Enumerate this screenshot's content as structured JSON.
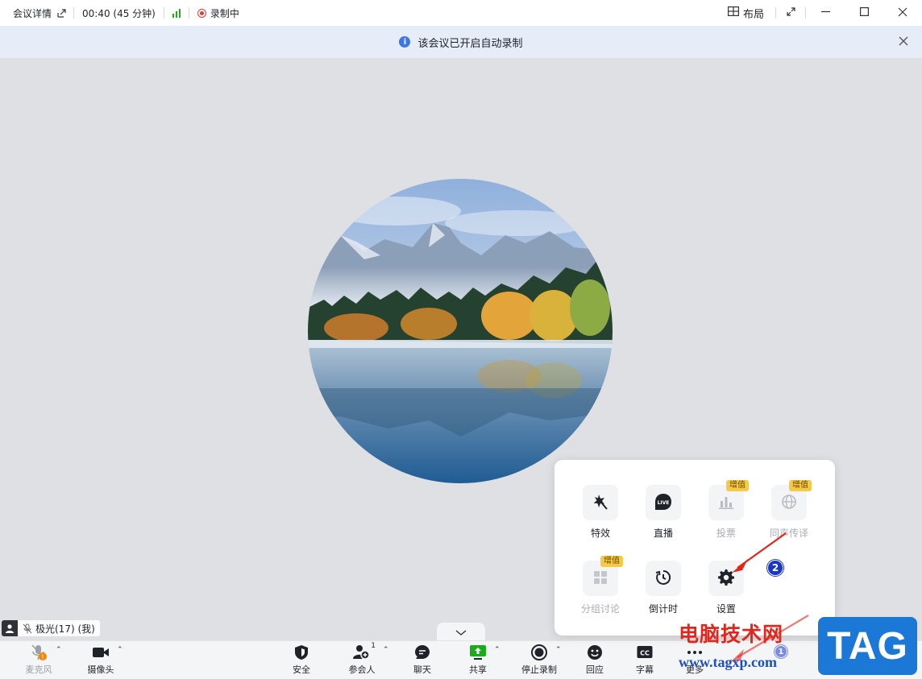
{
  "titlebar": {
    "title": "会议详情",
    "time": "00:40 (45 分钟)",
    "recording": "录制中",
    "layout": "布局"
  },
  "notice": {
    "text": "该会议已开启自动录制"
  },
  "participant": {
    "name": "极光(17) (我)"
  },
  "toolbar": {
    "mic": "麦克风",
    "camera": "摄像头",
    "security": "安全",
    "participants": "参会人",
    "participants_count": "1",
    "chat": "聊天",
    "share": "共享",
    "stop_record": "停止录制",
    "react": "回应",
    "captions": "字幕",
    "more": "更多",
    "more_badge": "1"
  },
  "popup": {
    "items": [
      {
        "label": "特效",
        "icon": "magic-wand-icon",
        "enabled": true
      },
      {
        "label": "直播",
        "icon": "live-icon",
        "enabled": true
      },
      {
        "label": "投票",
        "icon": "vote-icon",
        "enabled": false,
        "tag": "增值"
      },
      {
        "label": "同声传译",
        "icon": "globe-icon",
        "enabled": false,
        "tag": "增值"
      },
      {
        "label": "分组讨论",
        "icon": "breakout-icon",
        "enabled": false,
        "tag": "增值"
      },
      {
        "label": "倒计时",
        "icon": "timer-icon",
        "enabled": true
      },
      {
        "label": "设置",
        "icon": "gear-icon",
        "enabled": true
      }
    ]
  },
  "annotation": {
    "step": "2"
  },
  "watermark": {
    "site_name": "电脑技术网",
    "url": "www.tagxp.com",
    "logo": "TAG"
  },
  "colors": {
    "recording": "#e53935",
    "signal": "#1aad19",
    "notice_bg": "#e6edf9",
    "info": "#3a78e8",
    "share_green": "#1aad19",
    "plus_tag": "#f5c94a",
    "arrow": "#e3251c"
  }
}
